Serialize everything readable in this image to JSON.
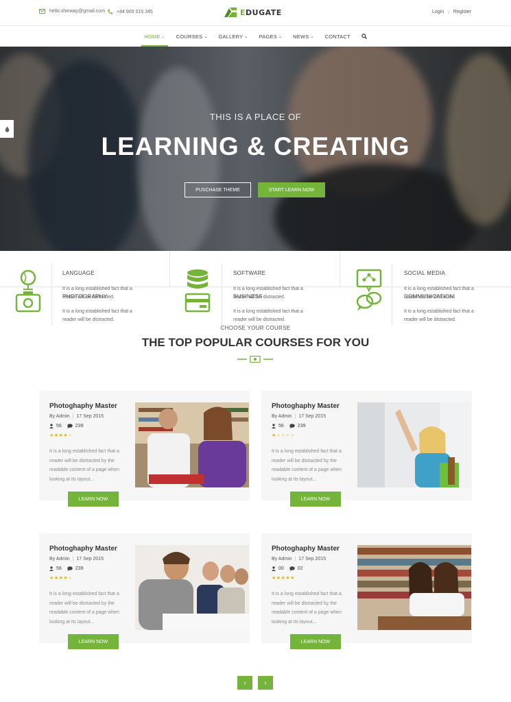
{
  "topbar": {
    "email": "hello.shinway@gmail.com",
    "phone": "+84 909 015 345",
    "logo_text": "EDUGATE",
    "login": "Login",
    "sep": "|",
    "register": "Register"
  },
  "nav": {
    "items": [
      {
        "label": "HOME",
        "chevron": true,
        "active": true
      },
      {
        "label": "COURSES",
        "chevron": true
      },
      {
        "label": "GALLERY",
        "chevron": true
      },
      {
        "label": "PAGES",
        "chevron": true
      },
      {
        "label": "NEWS",
        "chevron": true
      },
      {
        "label": "CONTACT",
        "chevron": false
      }
    ],
    "search_icon": "search-icon"
  },
  "hero": {
    "subtitle": "THIS IS A PLACE OF",
    "title": "LEARNING & CREATING",
    "btn_purchase": "PUSCHASE THEME",
    "btn_start": "START LEARN NOW"
  },
  "features": [
    {
      "title": "LANGUAGE",
      "ghost": "PHOTOGRAPHY",
      "text1": "It is a long established fact that a reader will be distracted.",
      "text2": "It is a long established fact that a reader will be distracted.",
      "icon": "camera-globe-icon"
    },
    {
      "title": "SOFTWARE",
      "ghost": "BUSINESS",
      "text1": "It is a long established fact that a reader will be distracted.",
      "text2": "It is a long established fact that a reader will be distracted.",
      "icon": "database-card-icon"
    },
    {
      "title": "SOCIAL MEDIA",
      "ghost": "COMMUNICATION",
      "text1": "It is a long established fact that a reader will be distracted.",
      "text2": "It is a long established fact that a reader will be distracted.",
      "icon": "chat-share-icon"
    }
  ],
  "section": {
    "kicker": "CHOOSE YOUR COURSE",
    "title": "THE TOP POPULAR COURSES FOR YOU"
  },
  "courses": [
    {
      "title": "Photoghaphy Master",
      "by": "By Admin",
      "sep": "|",
      "date": "17 Sep 2015",
      "students": "56",
      "comments": "239",
      "rating": 4,
      "desc": "It is a long established fact that a reader will be distracted by the readable content of a page when looking at its layout...",
      "btn": "LEARN NOW"
    },
    {
      "title": "Photoghaphy Master",
      "by": "By Admin",
      "sep": "|",
      "date": "17 Sep 2015",
      "students": "56",
      "comments": "239",
      "rating": 1,
      "desc": "It is a long established fact that a reader will be distracted by the readable content of a page when looking at its layout...",
      "btn": "LEARN NOW"
    },
    {
      "title": "Photoghaphy Master",
      "by": "By Admin",
      "sep": "|",
      "date": "17 Sep 2015",
      "students": "56",
      "comments": "239",
      "rating": 4,
      "desc": "It is a long established fact that a reader will be distracted by the readable content of a page when looking at its layout...",
      "btn": "LEARN NOW"
    },
    {
      "title": "Photoghaphy Master",
      "by": "By Admin",
      "sep": "|",
      "date": "17 Sep 2015",
      "students": "00",
      "comments": "02",
      "rating": 5,
      "desc": "It is a long established fact that a reader will be distracted by the readable content of a page when looking at its layout...",
      "btn": "LEARN NOW"
    }
  ],
  "pager": {
    "prev": "‹",
    "next": "›"
  },
  "colors": {
    "accent": "#74b43a"
  }
}
